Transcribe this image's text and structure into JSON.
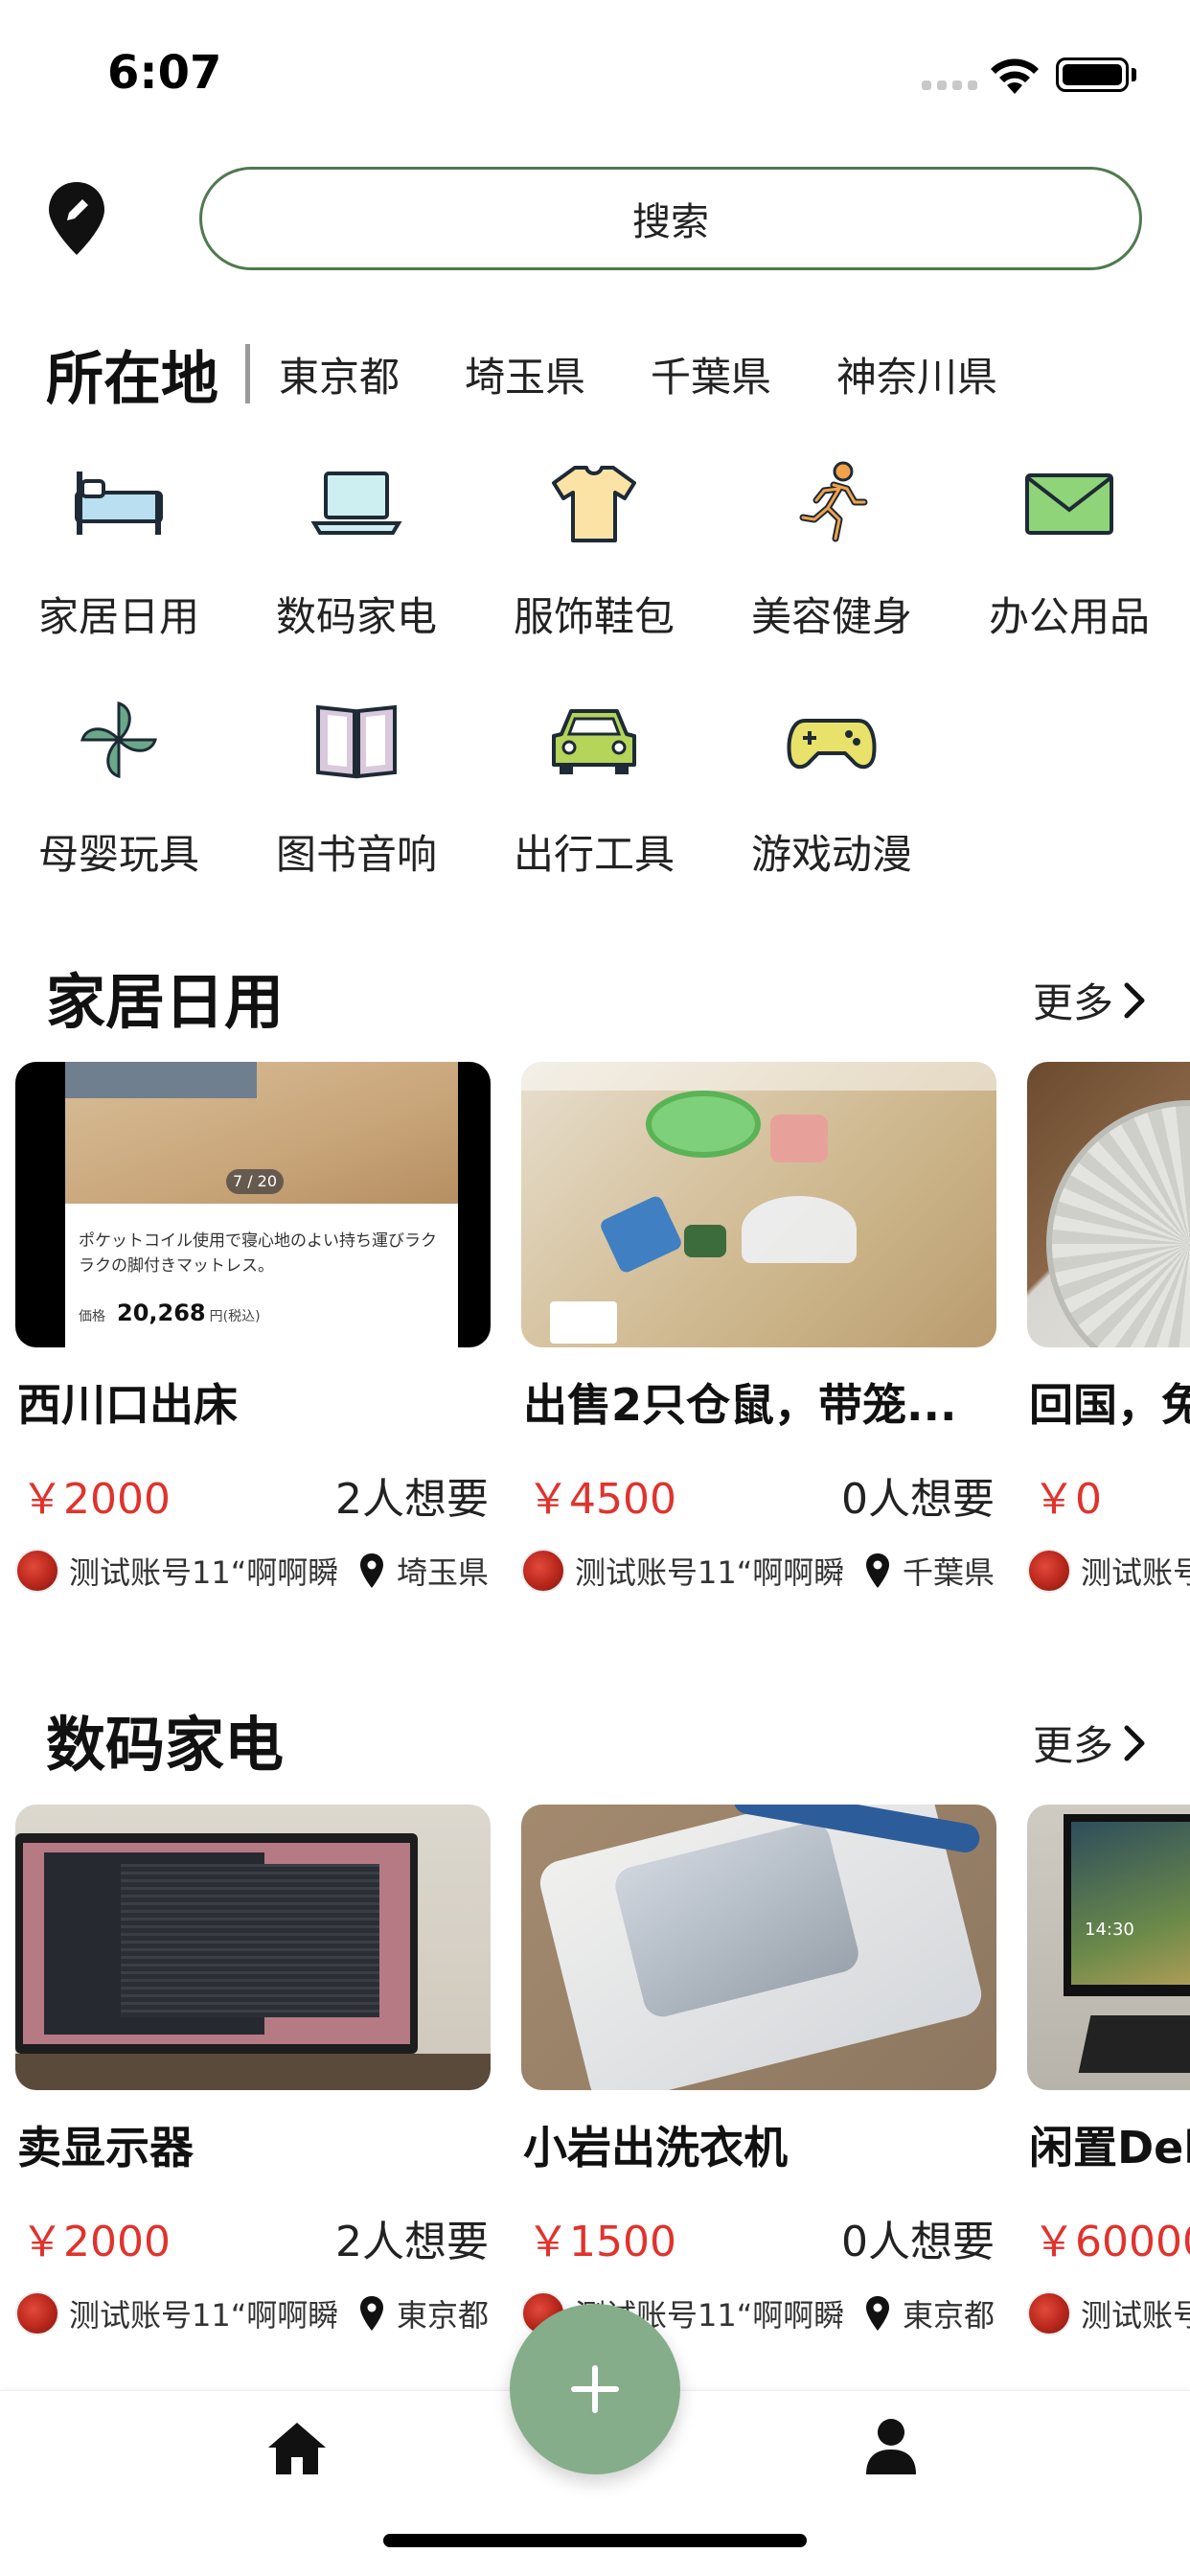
{
  "status_bar": {
    "time": "6:07"
  },
  "search": {
    "placeholder": "搜索"
  },
  "location": {
    "title": "所在地",
    "items": [
      "東京都",
      "埼玉県",
      "千葉県",
      "神奈川県"
    ]
  },
  "categories": [
    {
      "label": "家居日用",
      "icon": "bed-icon"
    },
    {
      "label": "数码家电",
      "icon": "laptop-icon"
    },
    {
      "label": "服饰鞋包",
      "icon": "tshirt-icon"
    },
    {
      "label": "美容健身",
      "icon": "running-icon"
    },
    {
      "label": "办公用品",
      "icon": "envelope-icon"
    },
    {
      "label": "母婴玩具",
      "icon": "pinwheel-icon"
    },
    {
      "label": "图书音响",
      "icon": "book-icon"
    },
    {
      "label": "出行工具",
      "icon": "car-icon"
    },
    {
      "label": "游戏动漫",
      "icon": "gamepad-icon"
    }
  ],
  "sections": [
    {
      "title": "家居日用",
      "more_label": "更多",
      "items": [
        {
          "title": "西川口出床",
          "price": "￥2000",
          "wants": "2人想要",
          "user": "测试账号11“啊啊瞬",
          "location": "埼玉県",
          "image_text": {
            "pager": "7 / 20",
            "desc": "ポケットコイル使用で寝心地のよい持ち運びラクラクの脚付きマットレス。",
            "price_label": "価格",
            "price_value": "20,268",
            "price_tax": "円(税込)"
          }
        },
        {
          "title": "出售2只仓鼠，带笼...",
          "price": "￥4500",
          "wants": "0人想要",
          "user": "测试账号11“啊啊瞬",
          "location": "千葉県"
        },
        {
          "title": "回国，免",
          "price": "￥0",
          "wants": "",
          "user": "测试账号",
          "location": ""
        }
      ]
    },
    {
      "title": "数码家电",
      "more_label": "更多",
      "items": [
        {
          "title": "卖显示器",
          "price": "￥2000",
          "wants": "2人想要",
          "user": "测试账号11“啊啊瞬",
          "location": "東京都"
        },
        {
          "title": "小岩出洗衣机",
          "price": "￥1500",
          "wants": "0人想要",
          "user": "测试账号11“啊啊瞬",
          "location": "東京都"
        },
        {
          "title": "闲置Del",
          "price": "￥60000",
          "wants": "",
          "user": "测试账号",
          "location": "",
          "image_text": {
            "clock": "14:30"
          }
        }
      ]
    }
  ],
  "tabbar": {
    "home_icon": "home-icon",
    "profile_icon": "user-icon",
    "add_icon": "plus-icon"
  },
  "colors": {
    "accent_green": "#86ad8a",
    "search_border": "#4f7a4f",
    "price_red": "#e0332d"
  }
}
